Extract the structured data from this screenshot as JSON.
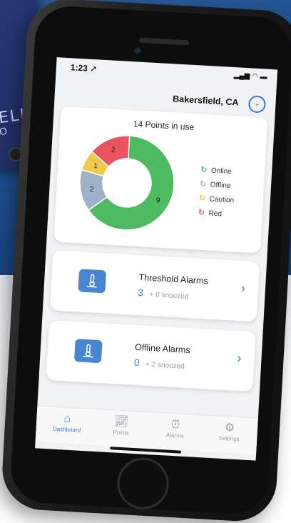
{
  "device": {
    "label": "ELD",
    "sublabel": "JO"
  },
  "status_bar": {
    "time": "1:23 ➚",
    "icons": "▂▄▆ ◠ ▬"
  },
  "header": {
    "location": "Bakersfield, CA",
    "location_button_icon": "chevron-down-circle-icon"
  },
  "chart_card": {
    "title": "14 Points in use"
  },
  "chart_data": {
    "type": "pie",
    "title": "14 Points in use",
    "slices": [
      {
        "label": "Online",
        "value": 9,
        "color": "#4dbb5f"
      },
      {
        "label": "Offline",
        "value": 2,
        "color": "#9fb2c9"
      },
      {
        "label": "Caution",
        "value": 1,
        "color": "#f0c94a"
      },
      {
        "label": "Red",
        "value": 2,
        "color": "#e9545e"
      }
    ],
    "legend_position": "right"
  },
  "alarms": [
    {
      "title": "Threshold Alarms",
      "count": "3",
      "snoozed": "+ 0 snoozed"
    },
    {
      "title": "Offline Alarms",
      "count": "0",
      "snoozed": "+ 2 snoozed"
    }
  ],
  "tabs": [
    {
      "label": "Dashboard",
      "icon": "home-icon"
    },
    {
      "label": "Points",
      "icon": "chart-icon"
    },
    {
      "label": "Alarms",
      "icon": "alarm-clock-icon"
    },
    {
      "label": "Settings",
      "icon": "gear-icon"
    }
  ]
}
